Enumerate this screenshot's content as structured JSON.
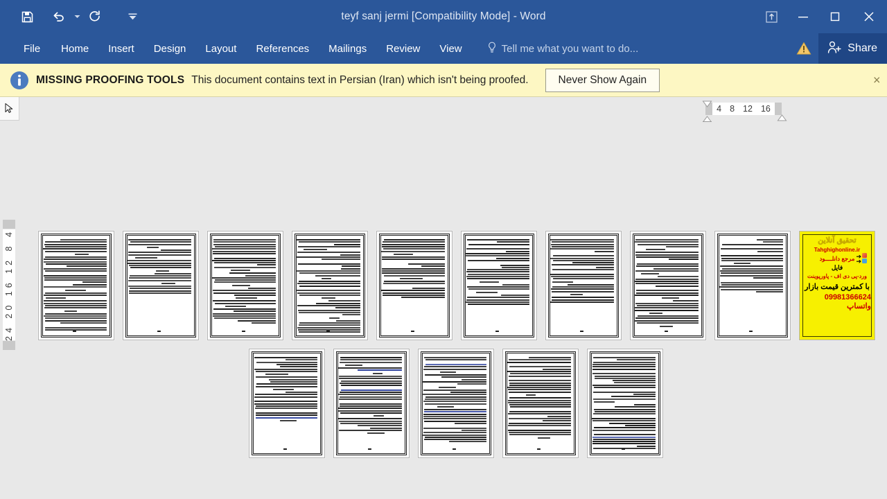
{
  "titlebar": {
    "document_title": "teyf sanj jermi [Compatibility Mode] - Word",
    "quick_access": [
      {
        "name": "save",
        "label": "Save"
      },
      {
        "name": "undo",
        "label": "Undo"
      },
      {
        "name": "undo-dropdown",
        "label": "Undo options"
      },
      {
        "name": "redo",
        "label": "Redo"
      },
      {
        "name": "customize-qat",
        "label": "Customize Quick Access Toolbar"
      }
    ],
    "window_controls": [
      {
        "name": "ribbon-display-options",
        "label": "Ribbon Display Options"
      },
      {
        "name": "minimize",
        "label": "Minimize"
      },
      {
        "name": "restore",
        "label": "Restore Down"
      },
      {
        "name": "close",
        "label": "Close"
      }
    ]
  },
  "ribbon": {
    "tabs": [
      {
        "label": "File"
      },
      {
        "label": "Home"
      },
      {
        "label": "Insert"
      },
      {
        "label": "Design"
      },
      {
        "label": "Layout"
      },
      {
        "label": "References"
      },
      {
        "label": "Mailings"
      },
      {
        "label": "Review"
      },
      {
        "label": "View"
      }
    ],
    "tell_me": "Tell me what you want to do...",
    "share_label": "Share",
    "warning_icon": "warning-triangle-icon",
    "accent_color": "#2b579a",
    "share_bg": "#1f4685"
  },
  "message_bar": {
    "icon": "info-icon",
    "strong": "MISSING PROOFING TOOLS",
    "text": "This document contains text in Persian (Iran) which isn't being proofed.",
    "button_label": "Never Show Again",
    "close_label": "×",
    "background": "#fdf7c3"
  },
  "rulers": {
    "tab_selector_icon": "left-tab-stop-icon",
    "horizontal_ticks": [
      "4",
      "8",
      "12",
      "16"
    ],
    "vertical_ticks": "24 20 16 12 8 4"
  },
  "document": {
    "page_count_row1": 10,
    "page_count_row2": 5,
    "zoom_view": "multiple-pages",
    "ad_page": {
      "line1": "تحقیق آنلاین",
      "line2": "Tahghighonline.ir",
      "line3": "مرجع دانلــــود",
      "line4": "فایل",
      "line5": "ورد-پی دی اف - پاورپوینت",
      "line6": "با کمترین قیمت بازار",
      "line7": "09981366624 واتساپ",
      "background": "#f7f000"
    }
  }
}
